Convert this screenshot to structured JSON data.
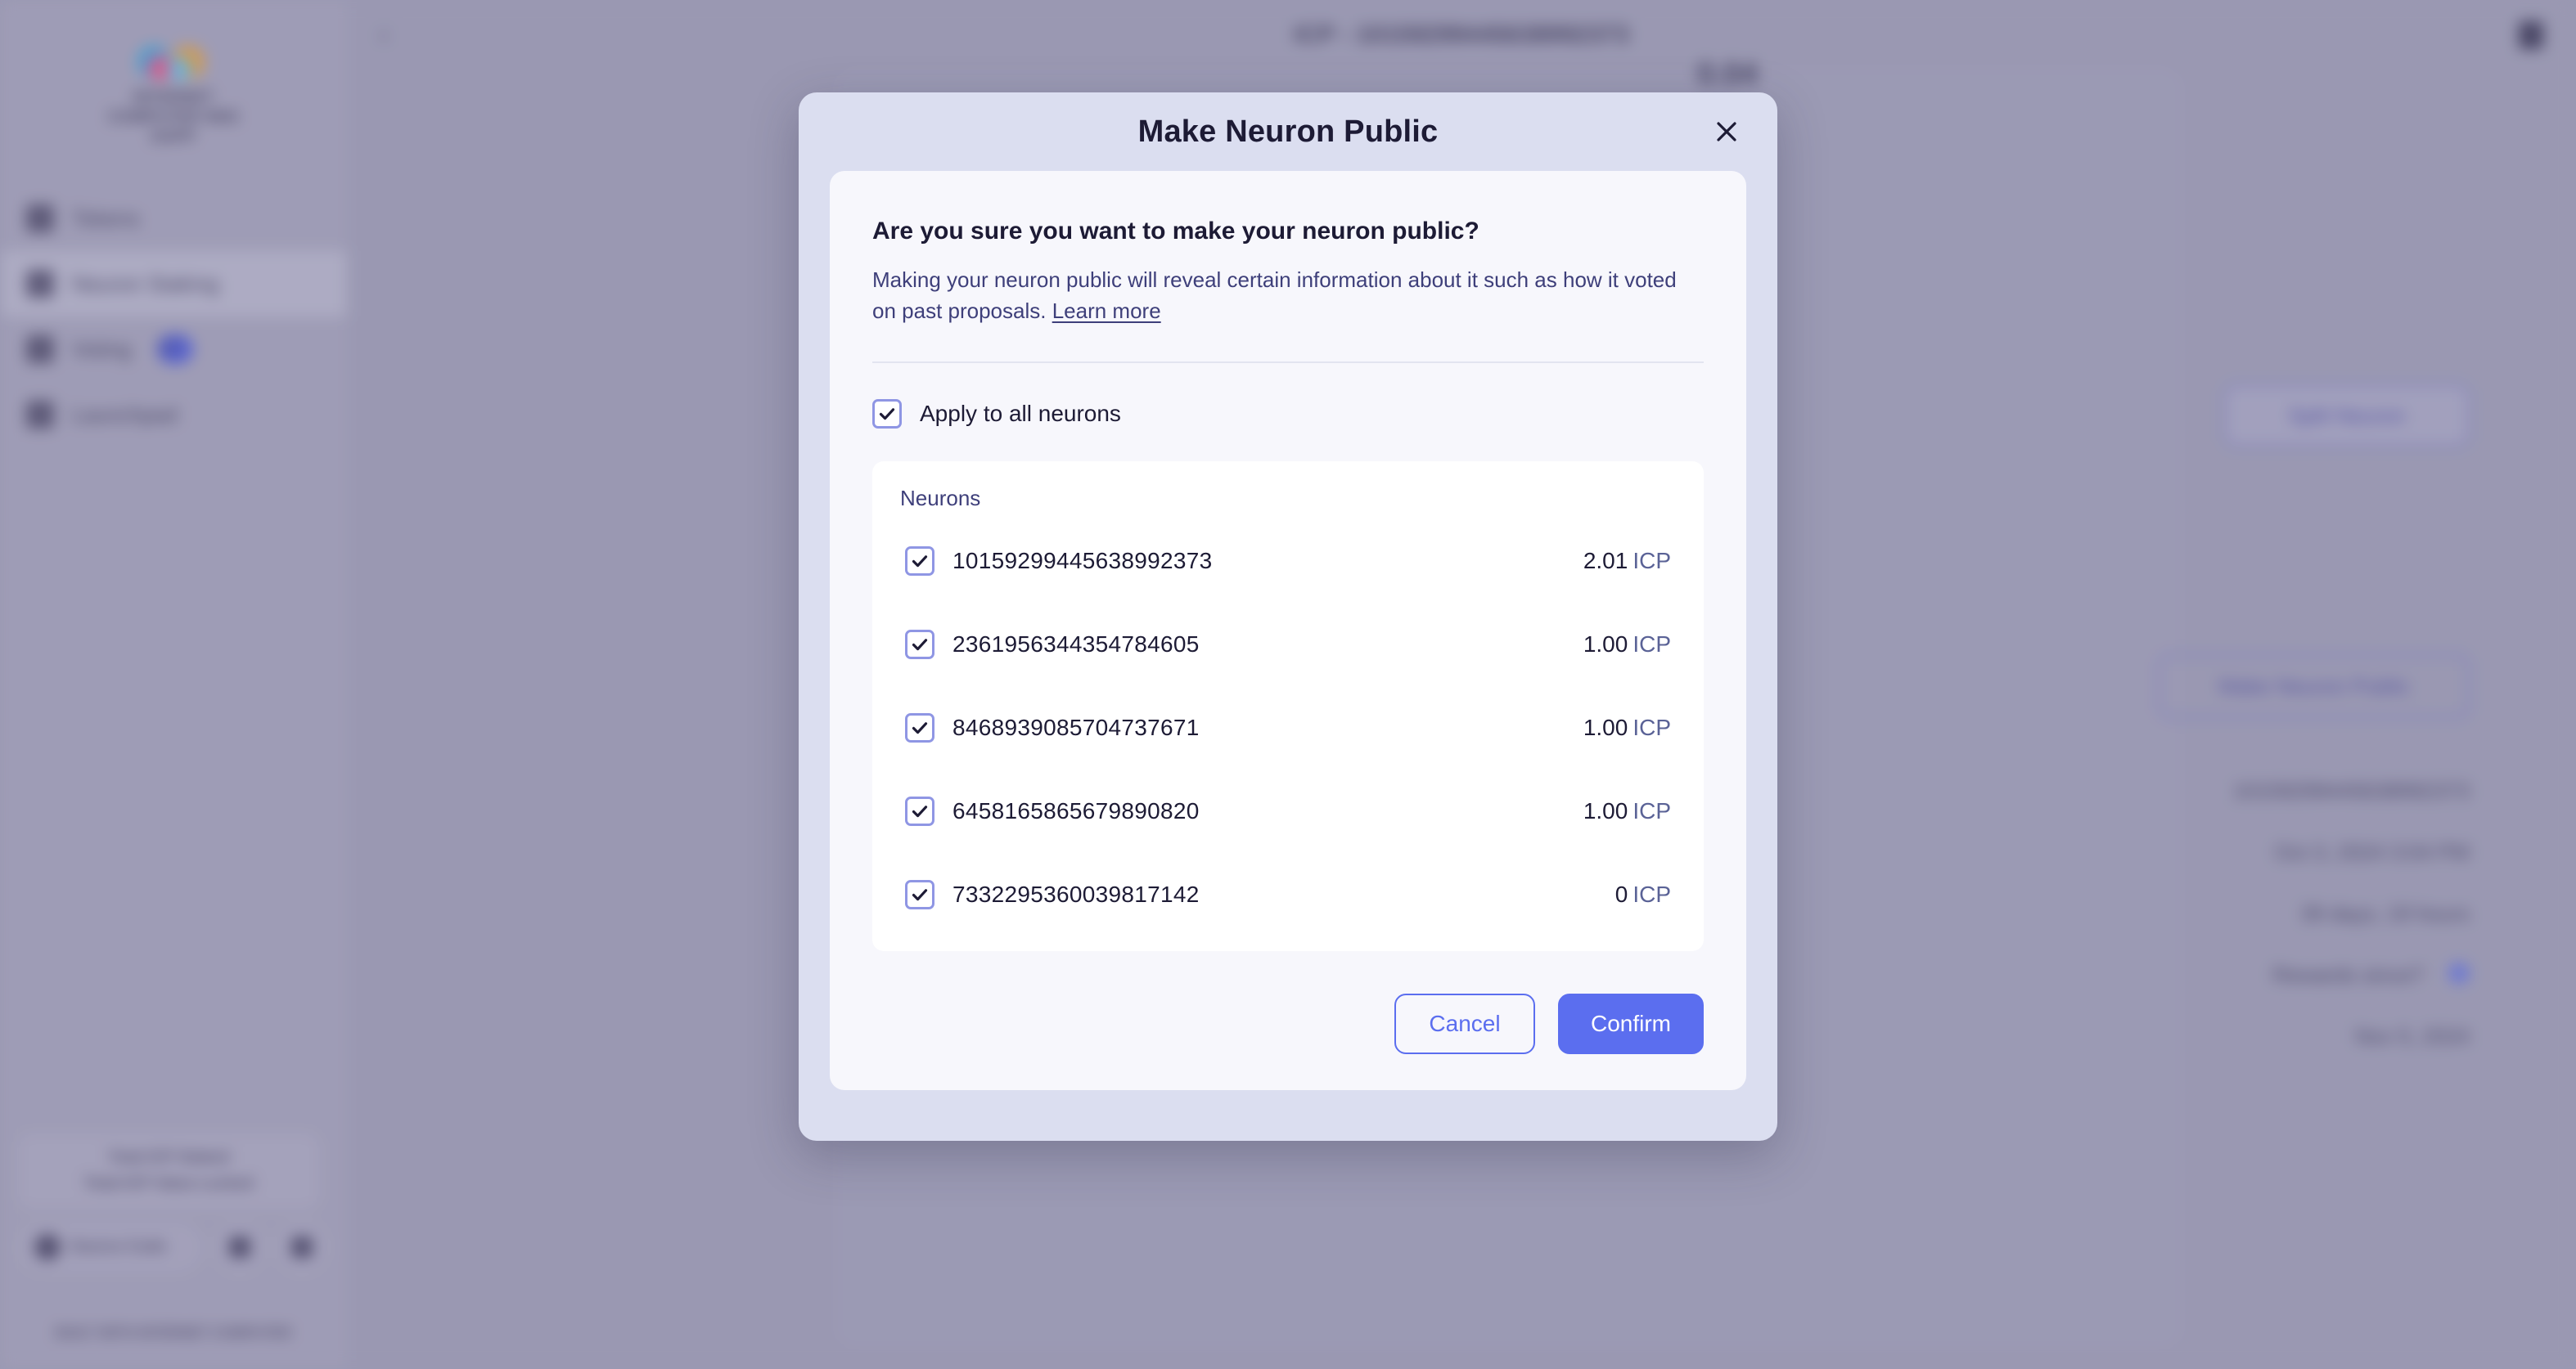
{
  "background": {
    "sidebar": {
      "logo_text": "INTERNET COMPUTER\nNNS DAPP",
      "items": [
        {
          "label": "Tokens",
          "icon": "coins-icon",
          "badge": ""
        },
        {
          "label": "Neuron Staking",
          "icon": "neuron-icon",
          "badge": ""
        },
        {
          "label": "Voting",
          "icon": "vote-icon",
          "badge": "12"
        },
        {
          "label": "Launchpad",
          "icon": "rocket-icon",
          "badge": ""
        }
      ],
      "card_line1": "Total ICP Staked",
      "card_line2": "Total ICP Value Locked",
      "source_code_label": "Source Code",
      "footer_text": "BUILT WITH\nINTERNET COMPUTER"
    },
    "topbar": {
      "back_icon": "chevron-left-icon",
      "title": "ICP - 10159299445638992373",
      "menu_icon": "menu-icon"
    },
    "panel": {
      "amount": "0.04",
      "split_neuron_label": "Split Neuron",
      "make_public_label": "Make Neuron Public",
      "detail_rows": [
        "10159299445638992373",
        "Oct 3, 2024 3:04 PM",
        "39 days, 19 hours",
        "Rewards since? ",
        "Nov 5, 2024"
      ]
    }
  },
  "modal": {
    "title": "Make Neuron Public",
    "close_icon": "close-icon",
    "confirm_question": "Are you sure you want to make your neuron public?",
    "description": "Making your neuron public will reveal certain information about it such as how it voted on past proposals.",
    "learn_more_label": "Learn more",
    "apply_all": {
      "label": "Apply to all neurons",
      "checked": true
    },
    "neurons_section_title": "Neurons",
    "neurons": [
      {
        "id": "10159299445638992373",
        "amount": "2.01",
        "unit": "ICP",
        "checked": true
      },
      {
        "id": "2361956344354784605",
        "amount": "1.00",
        "unit": "ICP",
        "checked": true
      },
      {
        "id": "8468939085704737671",
        "amount": "1.00",
        "unit": "ICP",
        "checked": true
      },
      {
        "id": "6458165865679890820",
        "amount": "1.00",
        "unit": "ICP",
        "checked": true
      },
      {
        "id": "7332295360039817142",
        "amount": "0",
        "unit": "ICP",
        "checked": true
      }
    ],
    "cancel_label": "Cancel",
    "confirm_label": "Confirm"
  },
  "colors": {
    "accent": "#5b6eef",
    "modal_frame": "#dbdef0",
    "card": "#f7f7fc",
    "text": "#1d1b35",
    "muted_link": "#3e3f7a",
    "checkbox_border": "#8f96e4"
  }
}
